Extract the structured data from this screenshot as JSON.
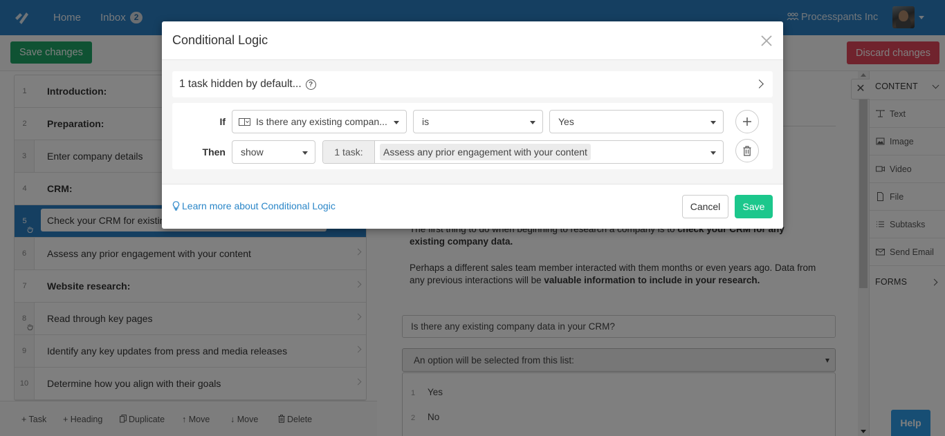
{
  "topnav": {
    "home_label": "Home",
    "inbox_label": "Inbox",
    "inbox_count": "2",
    "org_name": "Processpants Inc",
    "brand_color": "#2a7ec2"
  },
  "toolbar": {
    "save_changes_label": "Save changes",
    "discard_changes_label": "Discard changes"
  },
  "task_list": {
    "items": [
      {
        "num": "1",
        "label": "Introduction:",
        "type": "heading"
      },
      {
        "num": "2",
        "label": "Preparation:",
        "type": "heading"
      },
      {
        "num": "3",
        "label": "Enter company details",
        "type": "task"
      },
      {
        "num": "4",
        "label": "CRM:",
        "type": "heading"
      },
      {
        "num": "5",
        "label": "Check your CRM for existing company data",
        "type": "task",
        "selected": true
      },
      {
        "num": "6",
        "label": "Assess any prior engagement with your content",
        "type": "task"
      },
      {
        "num": "7",
        "label": "Website research:",
        "type": "heading"
      },
      {
        "num": "8",
        "label": "Read through key pages",
        "type": "task"
      },
      {
        "num": "9",
        "label": "Identify any key updates from press and media releases",
        "type": "task"
      },
      {
        "num": "10",
        "label": "Determine how you align with their goals",
        "type": "task"
      }
    ],
    "selected_edit_value": "Check your CRM for existin"
  },
  "bottom_actions": {
    "add_task": "+ Task",
    "add_heading": "+ Heading",
    "duplicate": "Duplicate",
    "move_up": "Move",
    "move_down": "Move",
    "delete": "Delete"
  },
  "main": {
    "para1_text": "The first thing to do when beginning to research a company is to ",
    "para1_bold": "check your CRM for any existing company data.",
    "para2_text": "Perhaps a different sales team member interacted with them months or even years ago. Data from any previous interactions will be ",
    "para2_bold": "valuable information to include in your research.",
    "question": "Is there any existing company data in your CRM?",
    "select_placeholder": "An option will be selected from this list:",
    "options": [
      {
        "num": "1",
        "label": "Yes"
      },
      {
        "num": "2",
        "label": "No"
      }
    ]
  },
  "right_panel": {
    "content_header": "CONTENT",
    "items": [
      {
        "icon": "text-icon",
        "label": "Text"
      },
      {
        "icon": "image-icon",
        "label": "Image"
      },
      {
        "icon": "video-icon",
        "label": "Video"
      },
      {
        "icon": "file-icon",
        "label": "File"
      },
      {
        "icon": "subtasks-icon",
        "label": "Subtasks"
      },
      {
        "icon": "email-icon",
        "label": "Send Email"
      }
    ],
    "forms_header": "FORMS"
  },
  "help_label": "Help",
  "modal": {
    "title": "Conditional Logic",
    "hidden_summary": "1 task hidden by default...",
    "rule": {
      "if_label": "If",
      "field_value": "Is there any existing compan...",
      "operator_value": "is",
      "compare_value": "Yes",
      "then_label": "Then",
      "action_value": "show",
      "task_count_label": "1 task:",
      "task_chip": "Assess any prior engagement with your content"
    },
    "learn_more_label": "Learn more about Conditional Logic",
    "cancel_label": "Cancel",
    "save_label": "Save",
    "save_color": "#1cc78c"
  }
}
